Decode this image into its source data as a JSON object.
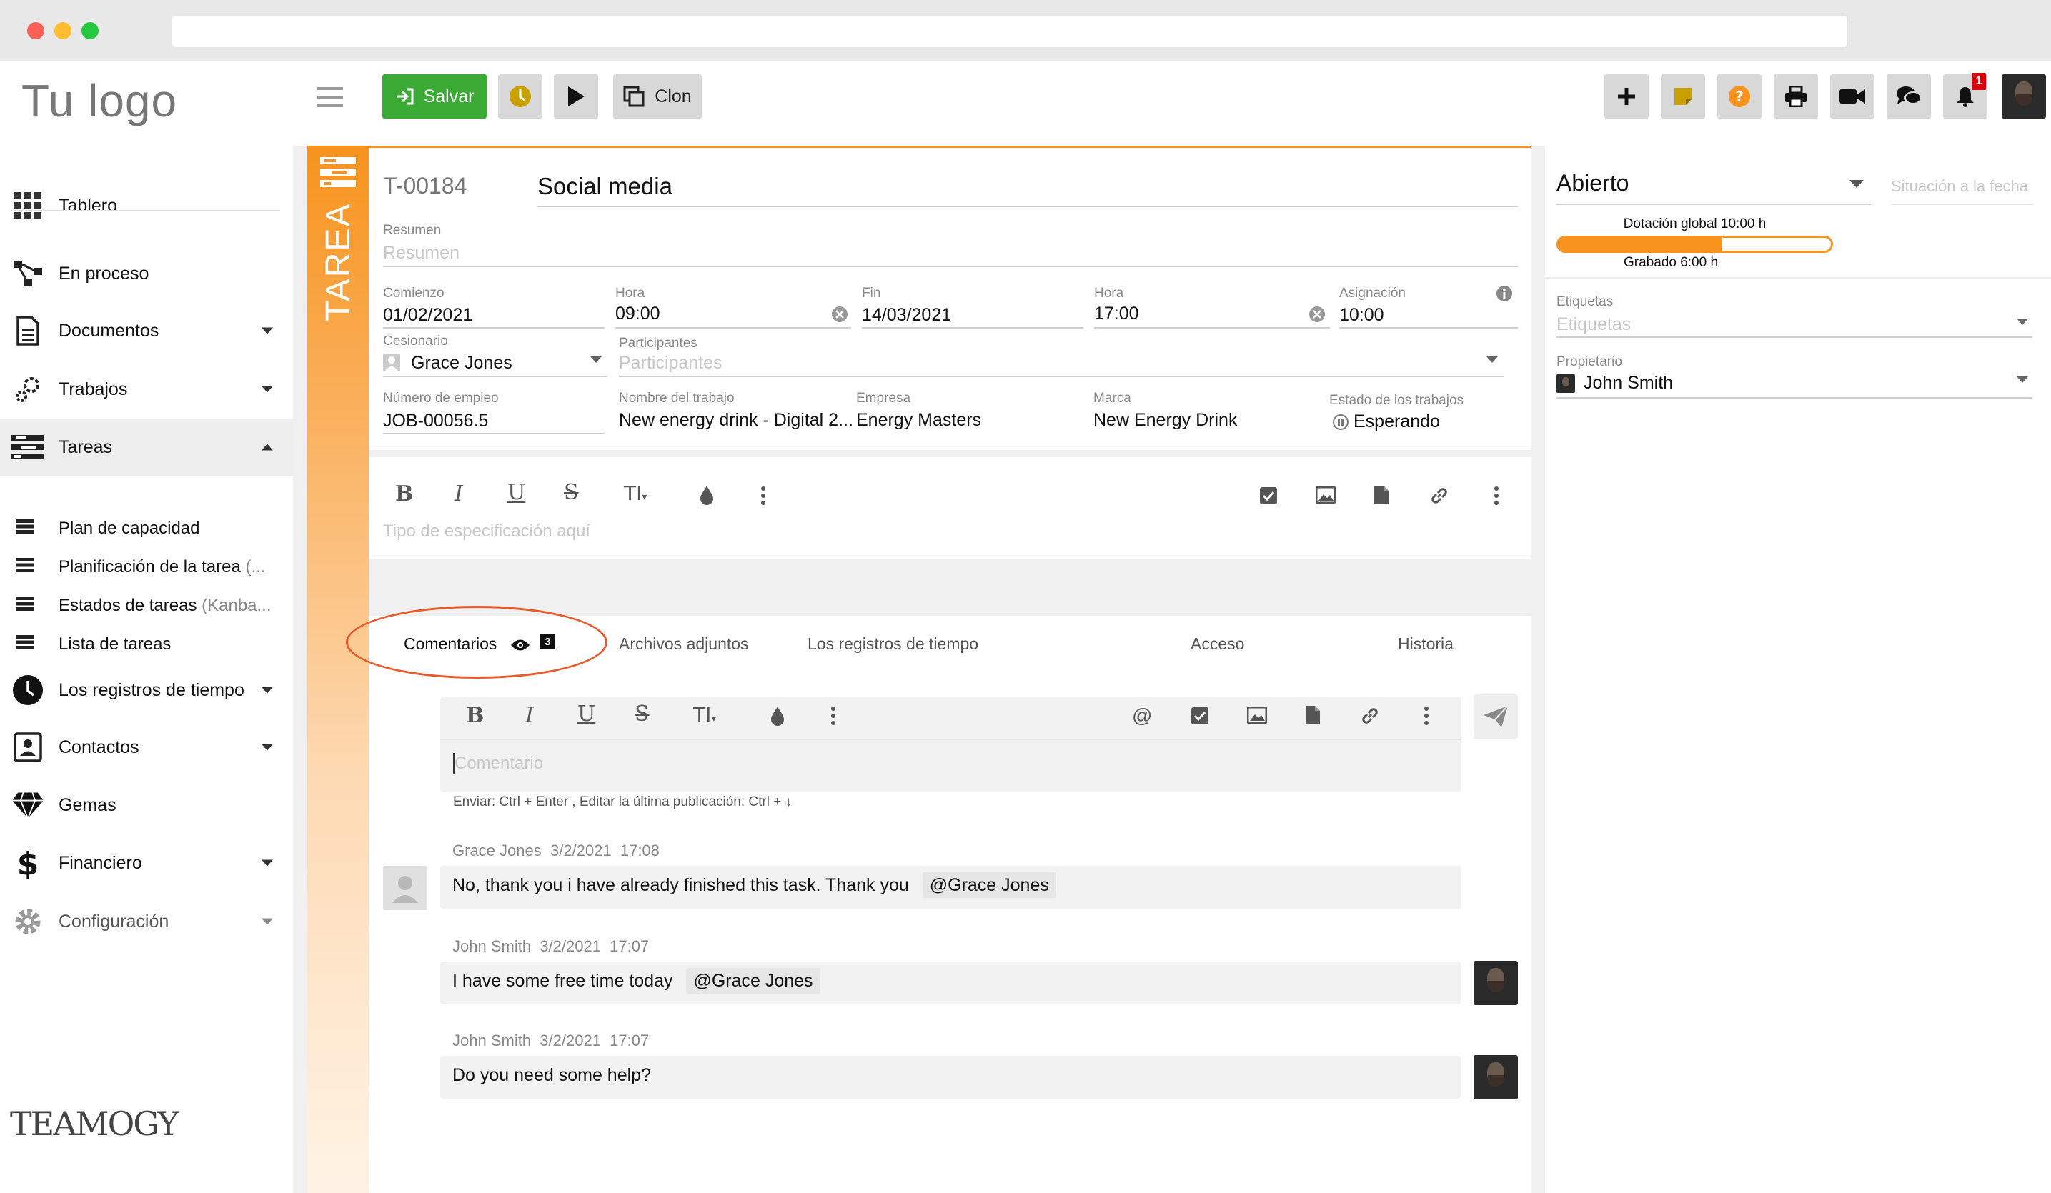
{
  "window": {
    "url": ""
  },
  "sidebar": {
    "logo": "Tu logo",
    "items": [
      {
        "label": "Tablero",
        "icon": "grid-icon"
      },
      {
        "label": "En proceso",
        "icon": "workflow-icon"
      },
      {
        "label": "Documentos",
        "icon": "document-icon"
      },
      {
        "label": "Trabajos",
        "icon": "jobs-icon"
      },
      {
        "label": "Tareas",
        "icon": "tasks-icon"
      },
      {
        "label": "Los registros de tiempo",
        "icon": "clock-icon"
      },
      {
        "label": "Contactos",
        "icon": "contacts-icon"
      },
      {
        "label": "Gemas",
        "icon": "gem-icon"
      },
      {
        "label": "Financiero",
        "icon": "dollar-icon"
      },
      {
        "label": "Configuración",
        "icon": "gear-icon"
      }
    ],
    "subitems": [
      {
        "label": "Plan de capacidad",
        "suffix": ""
      },
      {
        "label": "Planificación de la tarea",
        "suffix": " (..."
      },
      {
        "label": "Estados de tareas",
        "suffix": " (Kanba..."
      },
      {
        "label": "Lista de tareas",
        "suffix": ""
      }
    ],
    "brand": "TEAMOGY"
  },
  "toolbar": {
    "save_label": "Salvar",
    "clone_label": "Clon",
    "notification_count": "1",
    "icons": [
      "menu-icon",
      "save-icon",
      "timer-icon",
      "play-icon",
      "clone-icon",
      "plus-icon",
      "note-icon",
      "help-icon",
      "print-icon",
      "video-icon",
      "chat-icon",
      "bell-icon"
    ]
  },
  "task": {
    "side_label": "TAREA",
    "id": "T-00184",
    "title": "Social media",
    "summary_label": "Resumen",
    "summary_placeholder": "Resumen",
    "start_label": "Comienzo",
    "start_value": "01/02/2021",
    "start_time_label": "Hora",
    "start_time": "09:00",
    "end_label": "Fin",
    "end_value": "14/03/2021",
    "end_time_label": "Hora",
    "end_time": "17:00",
    "assignment_label": "Asignación",
    "assignment_value": "10:00",
    "assignee_label": "Cesionario",
    "assignee_value": "Grace Jones",
    "participants_label": "Participantes",
    "participants_placeholder": "Participantes",
    "job_number_label": "Número de empleo",
    "job_number": "JOB-00056.5",
    "job_name_label": "Nombre del trabajo",
    "job_name": "New energy drink - Digital 2...",
    "company_label": "Empresa",
    "company": "Energy Masters",
    "brand_label": "Marca",
    "brand": "New Energy Drink",
    "job_status_label": "Estado de los trabajos",
    "job_status": "Esperando",
    "spec_placeholder": "Tipo de especificación aquí"
  },
  "tabs": [
    {
      "label": "Comentarios",
      "badge": "3"
    },
    {
      "label": "Archivos adjuntos"
    },
    {
      "label": "Los registros de tiempo"
    },
    {
      "label": "Acceso"
    },
    {
      "label": "Historia"
    }
  ],
  "comments": {
    "placeholder": "Comentario",
    "hint": "Enviar: Ctrl + Enter , Editar la última publicación: Ctrl + ↓",
    "items": [
      {
        "author": "Grace Jones",
        "date": "3/2/2021",
        "time": "17:08",
        "text": "No, thank you i have already finished this task. Thank you",
        "mention": "@Grace Jones"
      },
      {
        "author": "John Smith",
        "date": "3/2/2021",
        "time": "17:07",
        "text": "I have some free time today",
        "mention": "@Grace Jones"
      },
      {
        "author": "John Smith",
        "date": "3/2/2021",
        "time": "17:07",
        "text": "Do you need some help?",
        "mention": ""
      }
    ]
  },
  "right_panel": {
    "status": "Abierto",
    "status_date_placeholder": "Situación a la fecha",
    "global_allocation": "Dotación global 10:00 h",
    "recorded": "Grabado 6:00 h",
    "progress_fraction": 0.6,
    "tags_label": "Etiquetas",
    "tags_placeholder": "Etiquetas",
    "owner_label": "Propietario",
    "owner": "John Smith"
  },
  "colors": {
    "accent": "#f7931e",
    "save_green": "#3aaa35",
    "timer_gold": "#c8a000",
    "help_orange": "#f7931e",
    "badge_red": "#d8000c"
  }
}
